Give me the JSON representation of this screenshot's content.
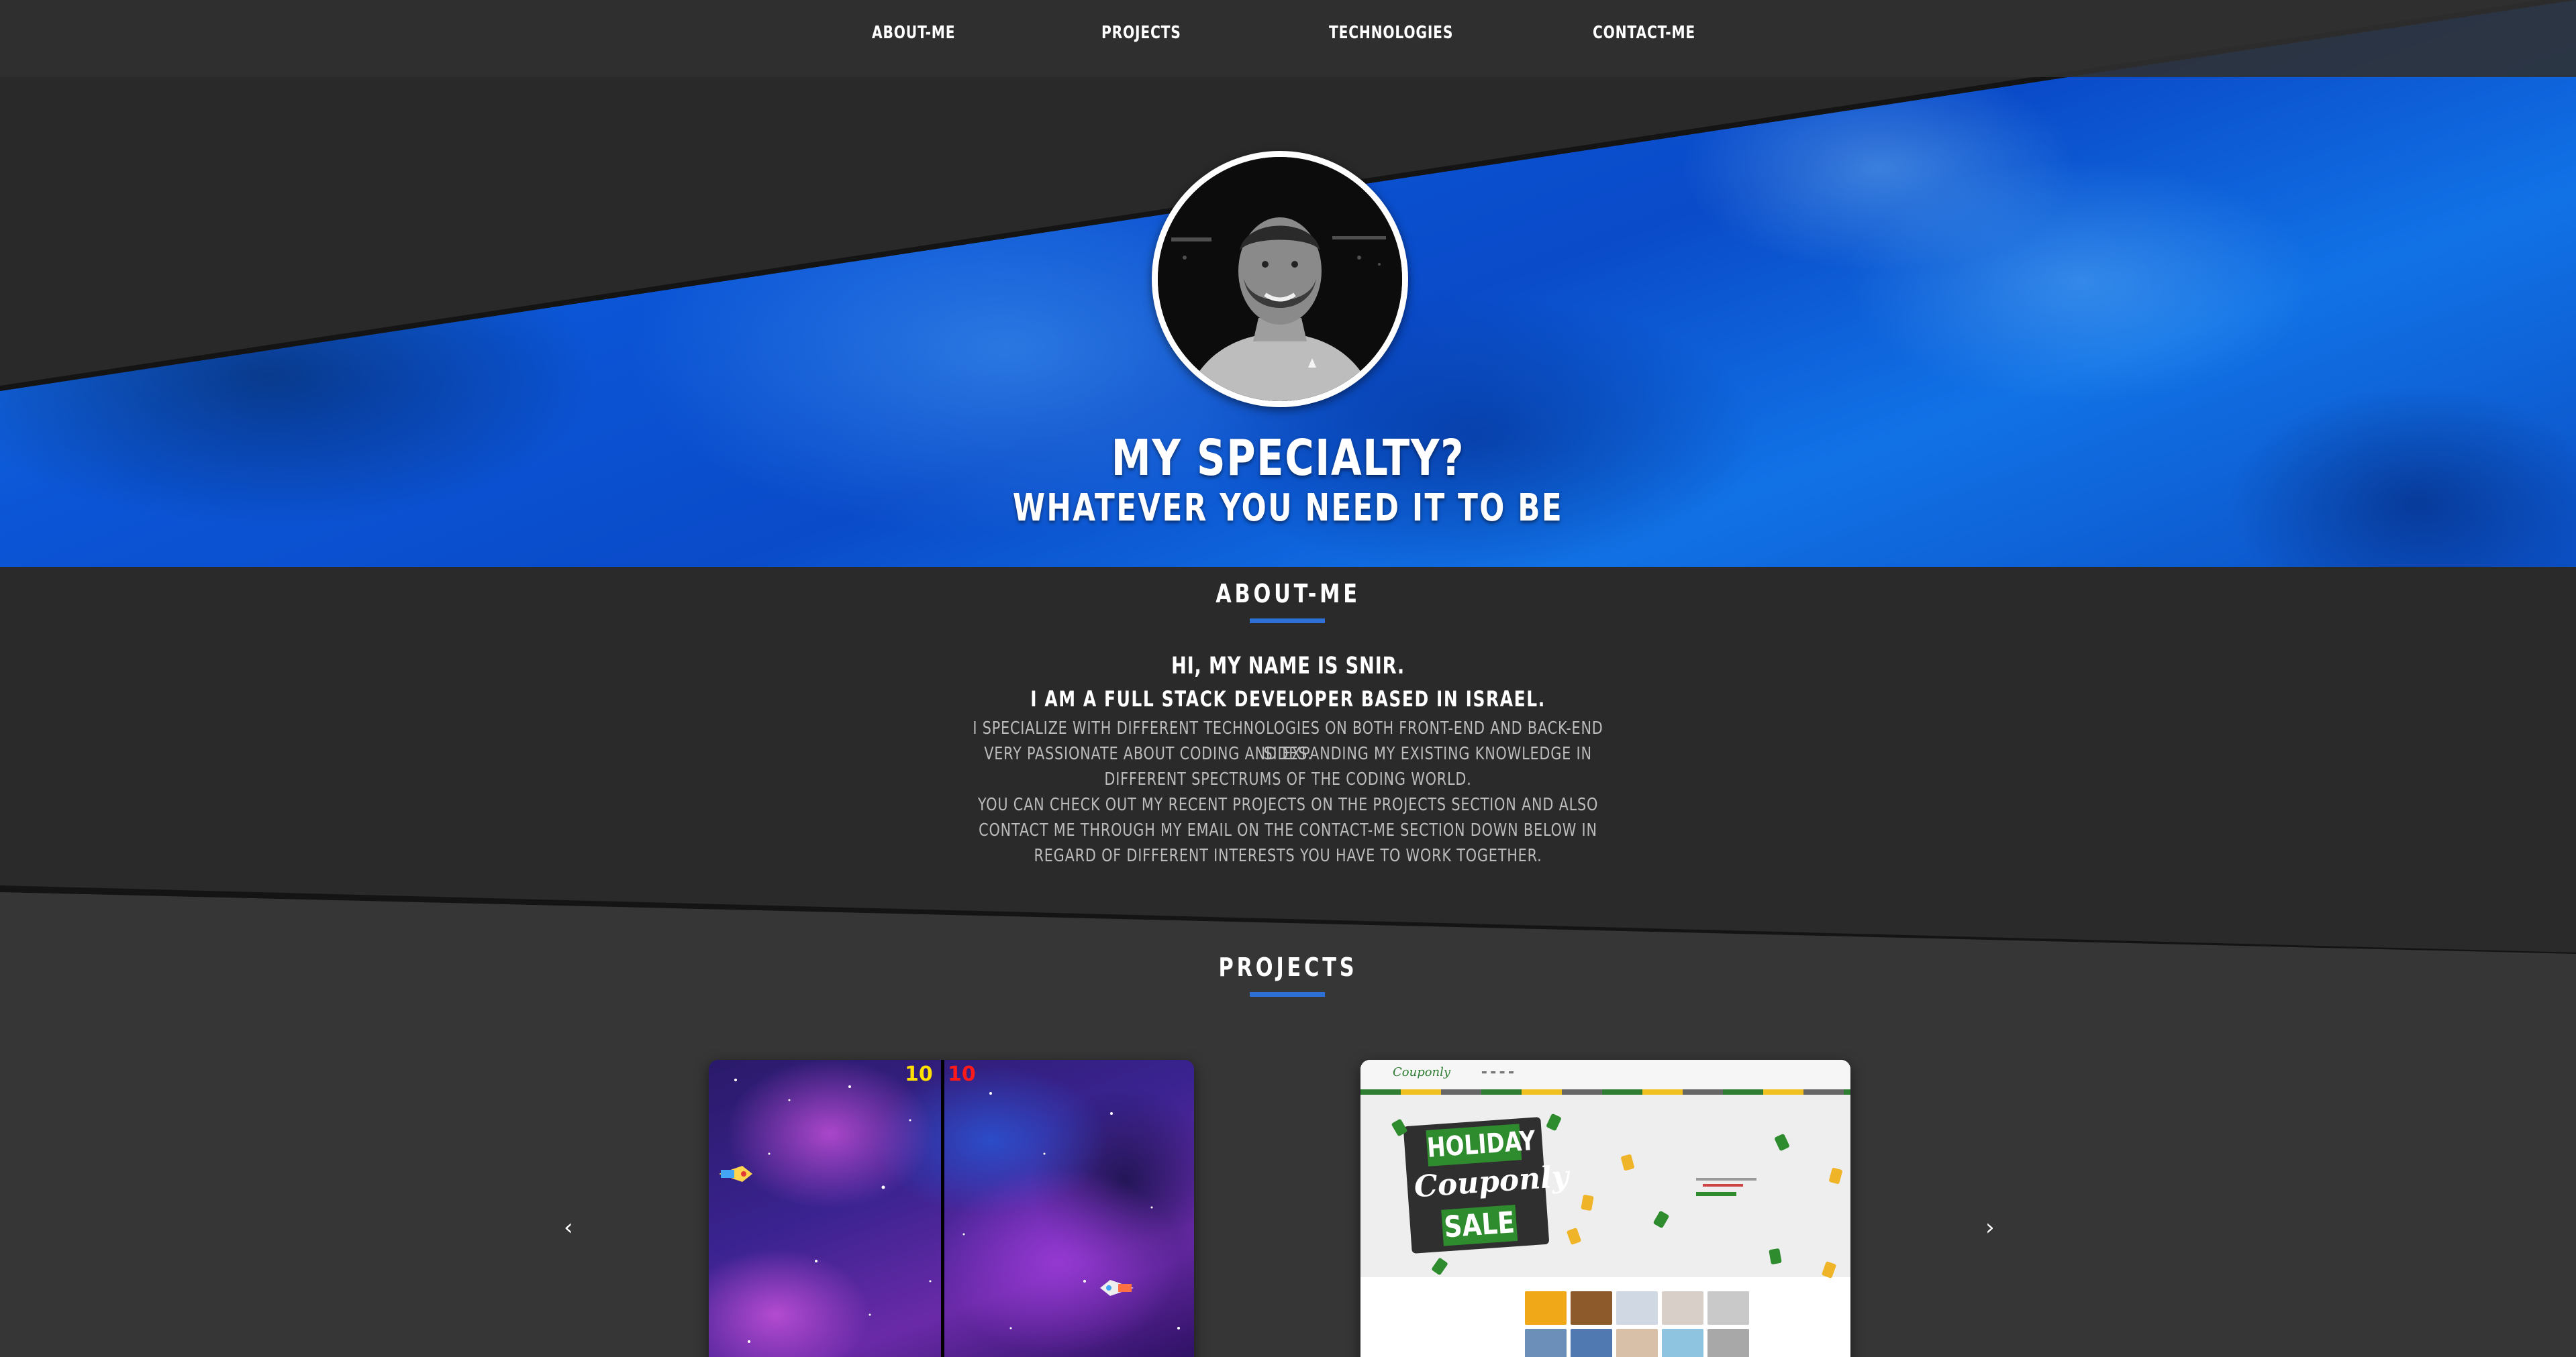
{
  "nav": {
    "items": [
      "ABOUT-ME",
      "PROJECTS",
      "TECHNOLOGIES",
      "CONTACT-ME"
    ]
  },
  "hero": {
    "title": "MY SPECIALTY?",
    "subtitle": "WHATEVER YOU NEED IT TO BE"
  },
  "about": {
    "heading": "ABOUT-ME",
    "greeting": "HI, MY NAME IS SNIR.",
    "role": "I AM A FULL STACK DEVELOPER BASED IN ISRAEL.",
    "paragraph_1": "I SPECIALIZE WITH DIFFERENT TECHNOLOGIES ON BOTH FRONT-END AND BACK-END SIDES.",
    "paragraph_2": "VERY PASSIONATE ABOUT CODING AND EXPANDING MY EXISTING KNOWLEDGE IN DIFFERENT SPECTRUMS OF THE CODING WORLD.",
    "paragraph_3": "YOU CAN CHECK OUT MY RECENT PROJECTS ON THE PROJECTS SECTION AND ALSO CONTACT ME THROUGH MY EMAIL ON THE CONTACT-ME SECTION DOWN BELOW IN REGARD OF DIFFERENT INTERESTS YOU HAVE TO WORK TOGETHER."
  },
  "projects": {
    "heading": "PROJECTS",
    "prev_arrow": "‹",
    "next_arrow": "›",
    "space_game": {
      "score_left": "10",
      "score_right": "10"
    },
    "couponly": {
      "logo": "Couponly",
      "sign_holiday": "HOLIDAY",
      "sign_brand": "Couponly",
      "sign_sale": "SALE"
    }
  },
  "colors": {
    "accent": "#2e6fd8",
    "hero_blue": "#0b55d6",
    "background": "#2a2a2a",
    "projects_background": "#363636"
  }
}
